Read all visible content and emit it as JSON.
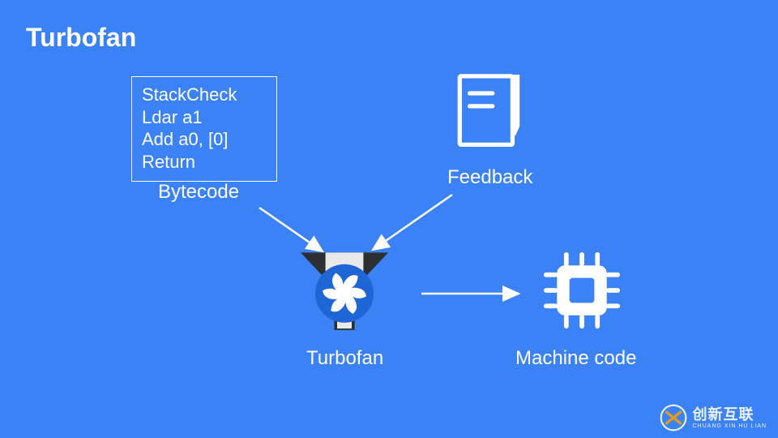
{
  "title": "Turbofan",
  "bytecode": {
    "lines": [
      "StackCheck",
      "Ldar a1",
      "Add a0, [0]",
      "Return"
    ],
    "label": "Bytecode"
  },
  "feedback": {
    "label": "Feedback"
  },
  "turbofan": {
    "label": "Turbofan"
  },
  "machinecode": {
    "label": "Machine code"
  },
  "watermark": {
    "brand": "创新互联",
    "sub": "CHUANG XIN HU LIAN"
  },
  "colors": {
    "bg": "#3b82f6",
    "text": "#ffffff",
    "boxBorder": "#ffffff",
    "fanRing": "#1e66d6",
    "fanDark": "#2d3033"
  }
}
